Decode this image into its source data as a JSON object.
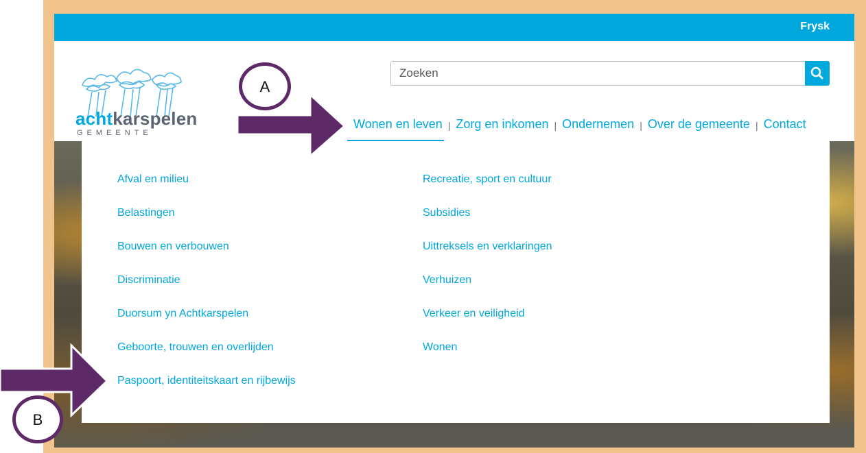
{
  "lang_link": "Frysk",
  "logo": {
    "name_prefix": "acht",
    "name_suffix": "karspelen",
    "subtitle": "GEMEENTE"
  },
  "search": {
    "placeholder": "Zoeken"
  },
  "nav": [
    {
      "label": "Wonen en leven",
      "active": true
    },
    {
      "label": "Zorg en inkomen"
    },
    {
      "label": "Ondernemen"
    },
    {
      "label": "Over de gemeente"
    },
    {
      "label": "Contact"
    }
  ],
  "nav_separator": "|",
  "dropdown": {
    "column1": [
      "Afval en milieu",
      "Belastingen",
      "Bouwen en verbouwen",
      "Discriminatie",
      "Duorsum yn Achtkarspelen",
      "Geboorte, trouwen en overlijden",
      "Paspoort, identiteitskaart en rijbewijs"
    ],
    "column2": [
      "Recreatie, sport en cultuur",
      "Subsidies",
      "Uittreksels en verklaringen",
      "Verhuizen",
      "Verkeer en veiligheid",
      "Wonen"
    ]
  },
  "annotations": {
    "marker_a": "A",
    "marker_b": "B"
  },
  "colors": {
    "brand_blue": "#00a8de",
    "frame": "#f1c38d",
    "annotation_purple": "#5d2a67",
    "logo_grey": "#5b6472"
  }
}
